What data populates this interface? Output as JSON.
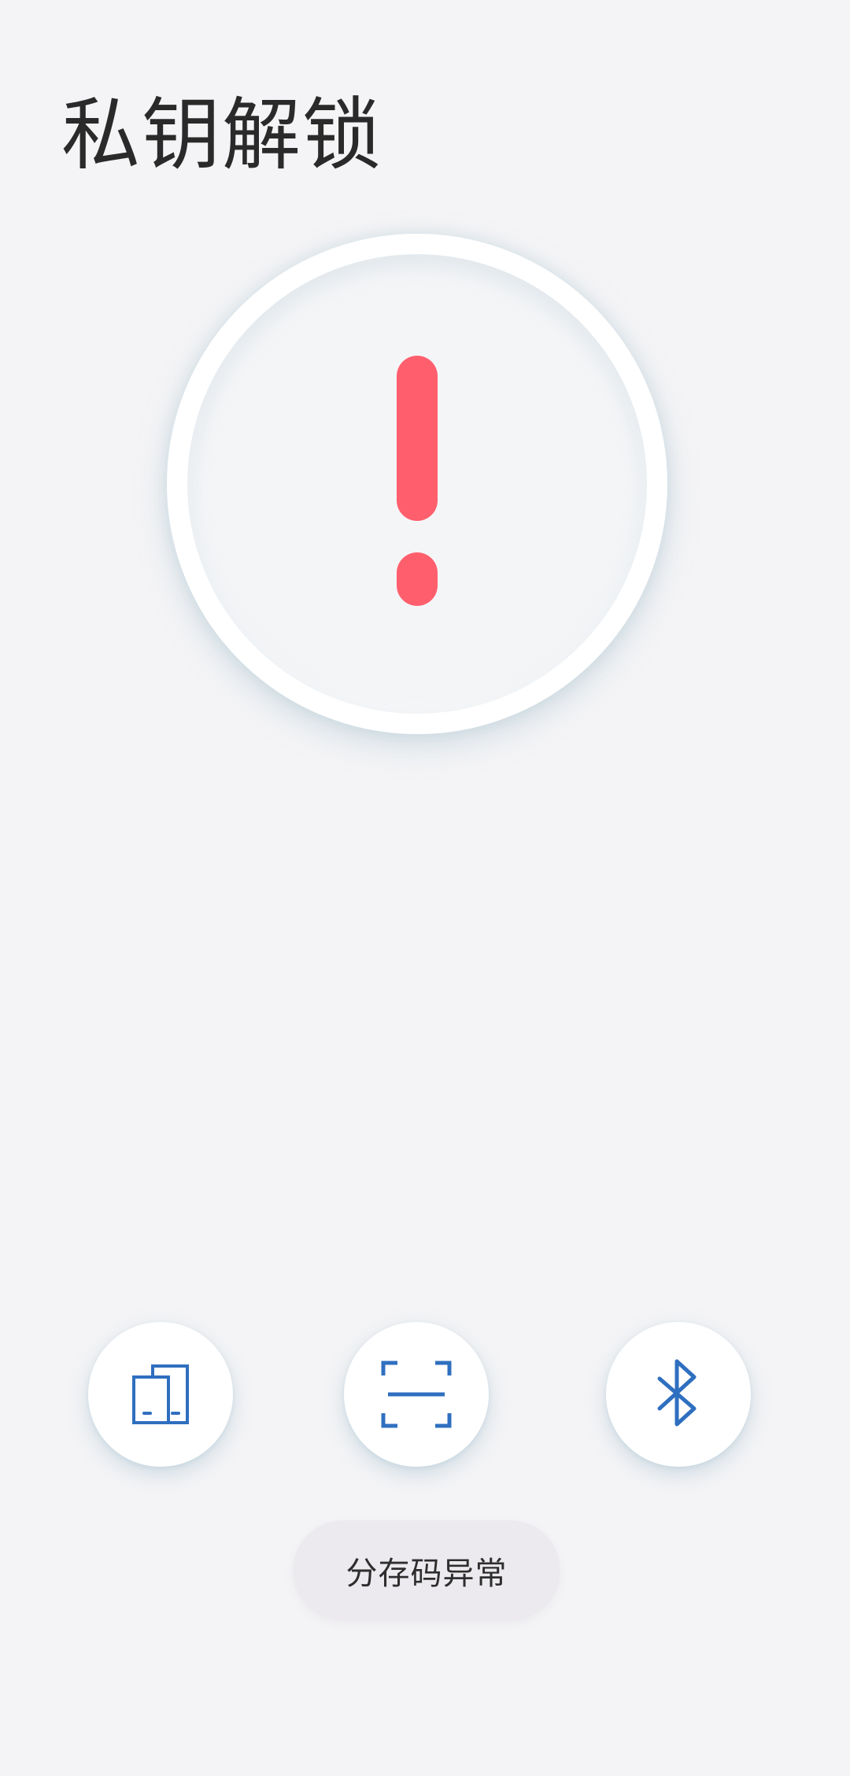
{
  "header": {
    "title": "私钥解锁"
  },
  "status": {
    "icon": "exclamation-icon",
    "color": "#ff5f6d"
  },
  "actions": [
    {
      "icon": "devices-icon",
      "color": "#2f6fbf"
    },
    {
      "icon": "scan-icon",
      "color": "#2f6fbf"
    },
    {
      "icon": "bluetooth-icon",
      "color": "#2f6fbf"
    }
  ],
  "toast": {
    "message": "分存码异常"
  },
  "colors": {
    "background": "#f4f4f6",
    "accent": "#2f6fbf",
    "alert": "#ff5f6d"
  }
}
